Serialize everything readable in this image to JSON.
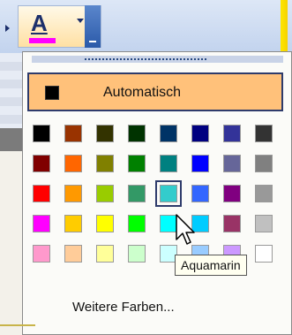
{
  "toolbar": {
    "font_color_button_glyph": "A",
    "font_color_bar": "#ff00ff",
    "icons": [
      "font-color-icon",
      "dropdown-arrow-icon",
      "toolbar-overflow-icon"
    ]
  },
  "popup": {
    "automatic_label": "Automatisch",
    "automatic_swatch": "#000000",
    "more_colors_label": "Weitere Farben...",
    "tooltip": "Aquamarin",
    "selected_color": "#33cccc",
    "palette": [
      [
        "#000000",
        "#993300",
        "#333300",
        "#003300",
        "#003366",
        "#000080",
        "#333399",
        "#333333"
      ],
      [
        "#800000",
        "#ff6600",
        "#808000",
        "#008000",
        "#008080",
        "#0000ff",
        "#666699",
        "#808080"
      ],
      [
        "#ff0000",
        "#ff9900",
        "#99cc00",
        "#339966",
        "#33cccc",
        "#3366ff",
        "#800080",
        "#999999"
      ],
      [
        "#ff00ff",
        "#ffcc00",
        "#ffff00",
        "#00ff00",
        "#00ffff",
        "#00ccff",
        "#993366",
        "#c0c0c0"
      ],
      [
        "#ff99cc",
        "#ffcc99",
        "#ffff99",
        "#ccffcc",
        "#ccffff",
        "#99ccff",
        "#cc99ff",
        "#ffffff"
      ]
    ]
  }
}
